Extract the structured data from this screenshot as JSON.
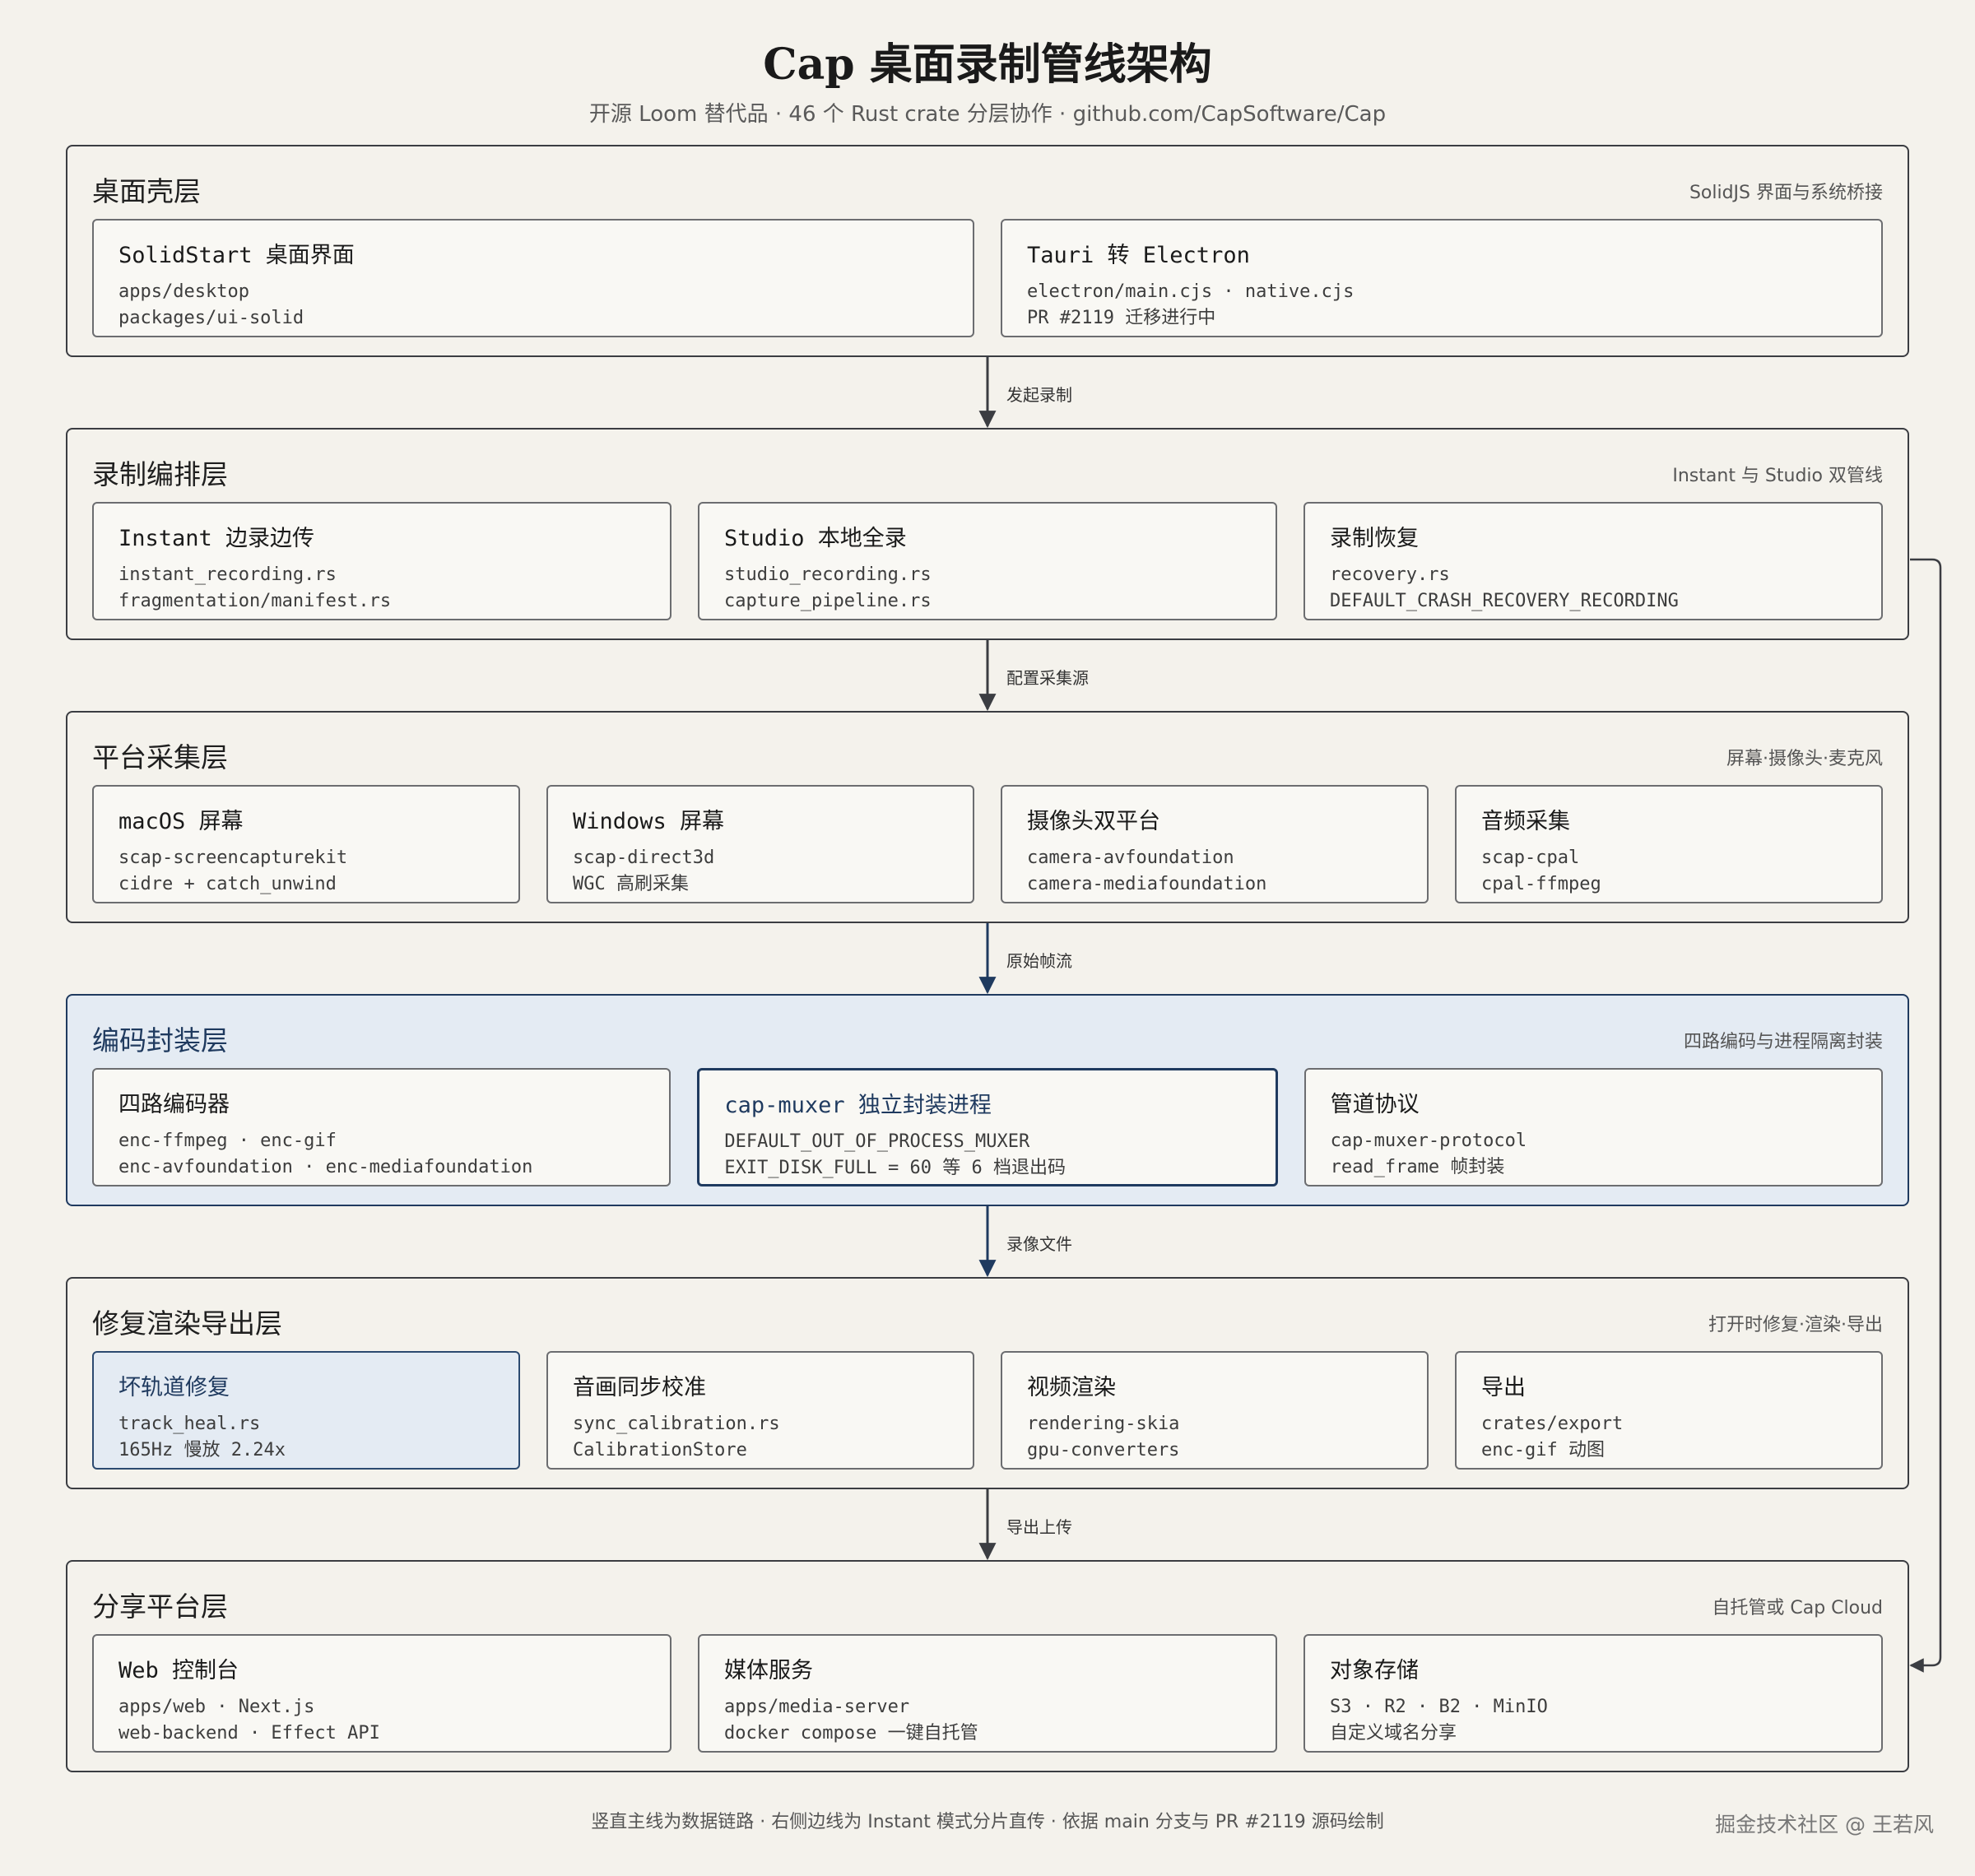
{
  "header": {
    "title": "Cap 桌面录制管线架构",
    "subtitle": "开源 Loom 替代品 · 46 个 Rust crate 分层协作 · github.com/CapSoftware/Cap"
  },
  "layers": [
    {
      "title": "桌面壳层",
      "note": "SolidJS 界面与系统桥接",
      "cards": [
        {
          "title": "SolidStart 桌面界面",
          "lines": [
            "apps/desktop",
            "packages/ui-solid"
          ]
        },
        {
          "title": "Tauri 转 Electron",
          "lines": [
            "electron/main.cjs · native.cjs",
            "PR #2119 迁移进行中"
          ]
        }
      ]
    },
    {
      "title": "录制编排层",
      "note": "Instant 与 Studio 双管线",
      "cards": [
        {
          "title": "Instant 边录边传",
          "lines": [
            "instant_recording.rs",
            "fragmentation/manifest.rs"
          ]
        },
        {
          "title": "Studio 本地全录",
          "lines": [
            "studio_recording.rs",
            "capture_pipeline.rs"
          ]
        },
        {
          "title": "录制恢复",
          "lines": [
            "recovery.rs",
            "DEFAULT_CRASH_RECOVERY_RECORDING"
          ]
        }
      ]
    },
    {
      "title": "平台采集层",
      "note": "屏幕·摄像头·麦克风",
      "cards": [
        {
          "title": "macOS 屏幕",
          "lines": [
            "scap-screencapturekit",
            "cidre + catch_unwind"
          ]
        },
        {
          "title": "Windows 屏幕",
          "lines": [
            "scap-direct3d",
            "WGC 高刷采集"
          ]
        },
        {
          "title": "摄像头双平台",
          "lines": [
            "camera-avfoundation",
            "camera-mediafoundation"
          ]
        },
        {
          "title": "音频采集",
          "lines": [
            "scap-cpal",
            "cpal-ffmpeg"
          ]
        }
      ]
    },
    {
      "title": "编码封装层",
      "note": "四路编码与进程隔离封装",
      "cards": [
        {
          "title": "四路编码器",
          "lines": [
            "enc-ffmpeg · enc-gif",
            "enc-avfoundation · enc-mediafoundation"
          ]
        },
        {
          "title": "cap-muxer 独立封装进程",
          "lines": [
            "DEFAULT_OUT_OF_PROCESS_MUXER",
            "EXIT_DISK_FULL = 60 等 6 档退出码"
          ]
        },
        {
          "title": "管道协议",
          "lines": [
            "cap-muxer-protocol",
            "read_frame 帧封装"
          ]
        }
      ]
    },
    {
      "title": "修复渲染导出层",
      "note": "打开时修复·渲染·导出",
      "cards": [
        {
          "title": "坏轨道修复",
          "lines": [
            "track_heal.rs",
            "165Hz 慢放 2.24x"
          ]
        },
        {
          "title": "音画同步校准",
          "lines": [
            "sync_calibration.rs",
            "CalibrationStore"
          ]
        },
        {
          "title": "视频渲染",
          "lines": [
            "rendering-skia",
            "gpu-converters"
          ]
        },
        {
          "title": "导出",
          "lines": [
            "crates/export",
            "enc-gif 动图"
          ]
        }
      ]
    },
    {
      "title": "分享平台层",
      "note": "自托管或 Cap Cloud",
      "cards": [
        {
          "title": "Web 控制台",
          "lines": [
            "apps/web · Next.js",
            "web-backend · Effect API"
          ]
        },
        {
          "title": "媒体服务",
          "lines": [
            "apps/media-server",
            "docker compose 一键自托管"
          ]
        },
        {
          "title": "对象存储",
          "lines": [
            "S3 · R2 · B2 · MinIO",
            "自定义域名分享"
          ]
        }
      ]
    }
  ],
  "arrows": [
    "发起录制",
    "配置采集源",
    "原始帧流",
    "录像文件",
    "导出上传"
  ],
  "footer": "竖直主线为数据链路 · 右侧边线为 Instant 模式分片直传 · 依据 main 分支与 PR #2119 源码绘制",
  "watermark": "掘金技术社区 @ 王若风",
  "colors": {
    "background": "#f4f2ec",
    "accent": "#1f3a5f",
    "highlight_fill": "#e4ebf3",
    "border": "#3b3d42"
  }
}
